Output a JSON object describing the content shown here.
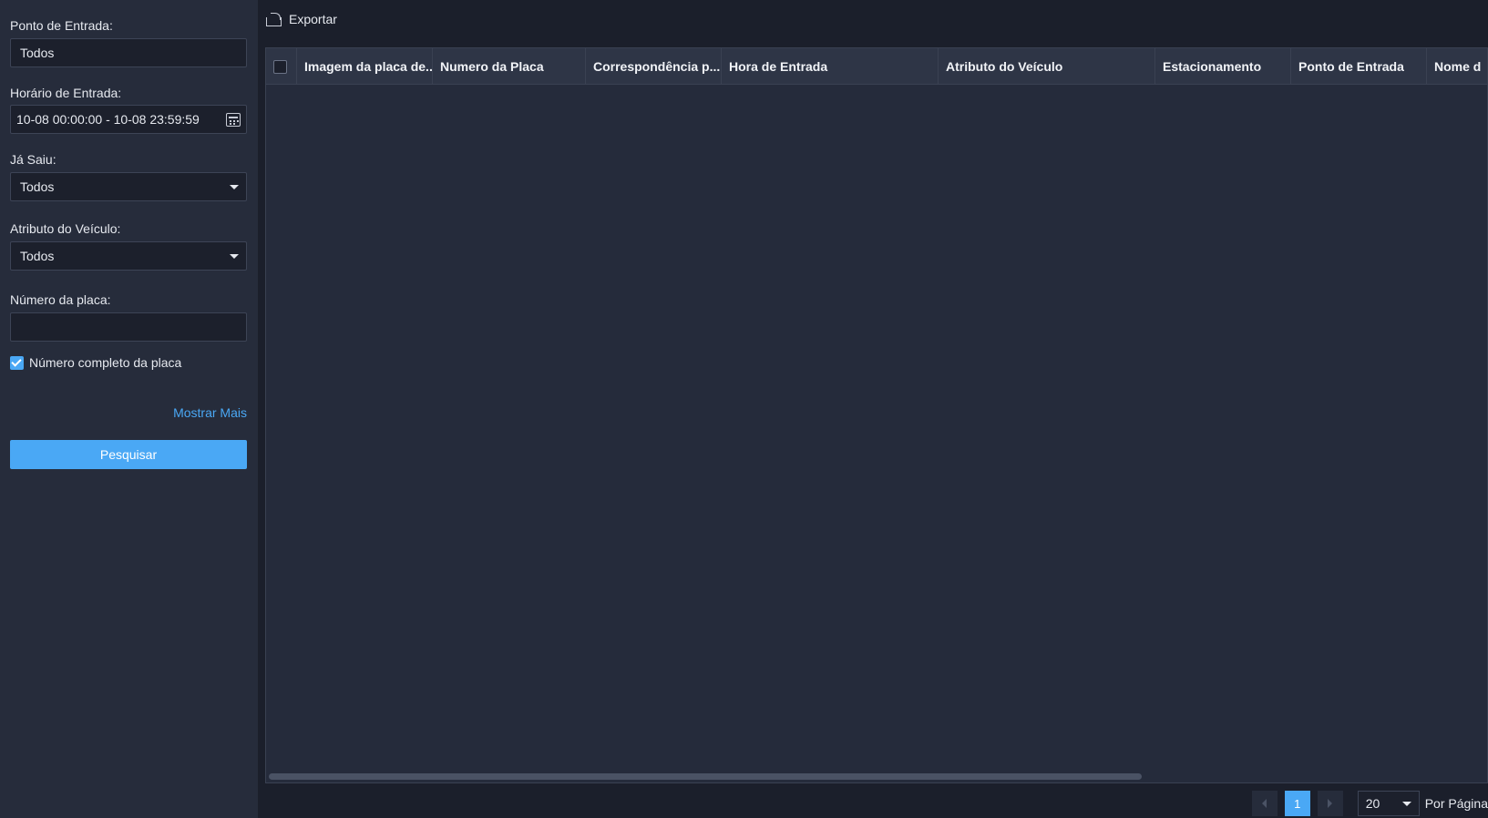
{
  "filters": {
    "entry_point": {
      "label": "Ponto de Entrada:",
      "value": "Todos"
    },
    "entry_time": {
      "label": "Horário de Entrada:",
      "value": "10-08 00:00:00 - 10-08 23:59:59"
    },
    "exited": {
      "label": "Já Saiu:",
      "value": "Todos"
    },
    "vehicle_attribute": {
      "label": "Atributo do Veículo:",
      "value": "Todos"
    },
    "plate_number": {
      "label": "Número da placa:",
      "value": ""
    },
    "full_plate": {
      "label": "Número completo da placa",
      "checked": true
    },
    "show_more": "Mostrar Mais",
    "search_button": "Pesquisar"
  },
  "toolbar": {
    "export_label": "Exportar"
  },
  "table": {
    "columns": [
      "Imagem da placa de...",
      "Numero da Placa",
      "Correspondência p...",
      "Hora de Entrada",
      "Atributo do Veículo",
      "Estacionamento",
      "Ponto de Entrada",
      "Nome d"
    ],
    "rows": []
  },
  "pagination": {
    "current_page": "1",
    "page_size": "20",
    "per_page_label": "Por Página"
  },
  "colors": {
    "accent": "#4aa8f5",
    "sidebar_bg": "#262c3b",
    "table_bg": "#252b3b",
    "header_bg": "#2e3546"
  }
}
